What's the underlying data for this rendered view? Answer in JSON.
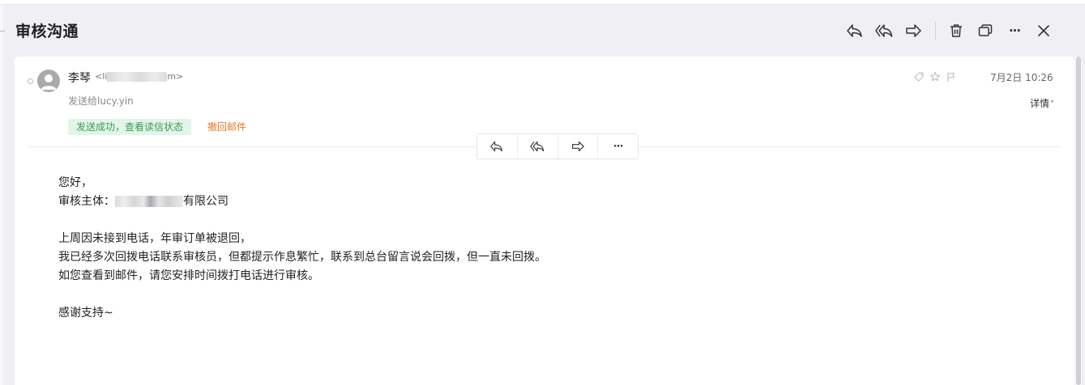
{
  "header": {
    "title": "审核沟通",
    "toolbar": [
      {
        "name": "reply-icon"
      },
      {
        "name": "reply-all-icon"
      },
      {
        "name": "forward-icon"
      },
      {
        "name": "delete-icon"
      },
      {
        "name": "open-window-icon"
      },
      {
        "name": "more-icon",
        "glyph": "···"
      },
      {
        "name": "close-icon"
      }
    ]
  },
  "message": {
    "sender_name": "李琴",
    "sender_email_prefix": "<li",
    "sender_email_suffix": "m>",
    "sent_to": "发送给lucy.yin",
    "status_badge": "发送成功，查看读信状态",
    "recall_link": "撤回邮件",
    "date": "7月2日 10:26",
    "details_label": "详情",
    "details_chevron": "˅"
  },
  "float_actions": [
    {
      "name": "reply-icon"
    },
    {
      "name": "reply-all-icon"
    },
    {
      "name": "forward-icon"
    },
    {
      "name": "more-icon",
      "glyph": "···"
    }
  ],
  "body": {
    "greeting": "您好，",
    "subject_label": "审核主体：",
    "subject_company_suffix": "有限公司",
    "line1": "上周因未接到电话，年审订单被退回，",
    "line2": "我已经多次回拨电话联系审核员，但都提示作息繁忙，联系到总台留言说会回拨，但一直未回拨。",
    "line3": "如您查看到邮件，请您安排时间拨打电话进行审核。",
    "closing": "感谢支持~"
  },
  "colors": {
    "badge_bg": "#e3f5e8",
    "badge_text": "#3b9a58",
    "recall_text": "#e47a2e",
    "background": "#f0f0f4"
  }
}
